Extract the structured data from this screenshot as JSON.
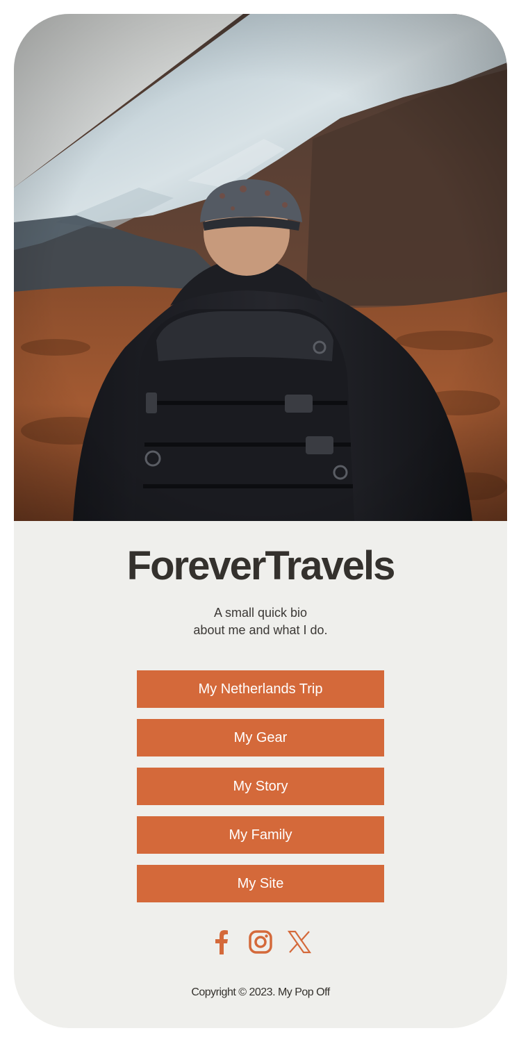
{
  "profile": {
    "title": "ForeverTravels",
    "bio_line1": "A small quick bio",
    "bio_line2": "about me and what I do."
  },
  "links": [
    {
      "label": "My Netherlands Trip"
    },
    {
      "label": "My Gear"
    },
    {
      "label": "My Story"
    },
    {
      "label": "My Family"
    },
    {
      "label": "My Site"
    }
  ],
  "social": [
    {
      "icon": "facebook-icon"
    },
    {
      "icon": "instagram-icon"
    },
    {
      "icon": "x-twitter-icon"
    }
  ],
  "footer": {
    "copyright": "Copyright © 2023. My Pop Off"
  },
  "colors": {
    "accent": "#d4693a",
    "background": "#efefec",
    "text": "#34312d"
  }
}
